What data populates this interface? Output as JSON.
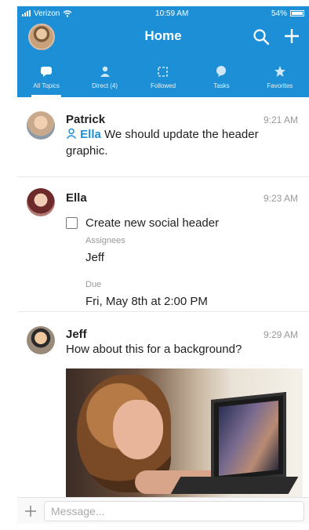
{
  "status_bar": {
    "carrier": "Verizon",
    "time": "10:59 AM",
    "battery": "54%"
  },
  "header": {
    "title": "Home"
  },
  "tabs": [
    {
      "label": "All Topics",
      "icon": "chat-bubble-icon",
      "active": true
    },
    {
      "label": "Direct (4)",
      "icon": "person-icon",
      "active": false
    },
    {
      "label": "Followed",
      "icon": "puzzle-icon",
      "active": false
    },
    {
      "label": "Tasks",
      "icon": "bubble-icon",
      "active": false
    },
    {
      "label": "Favorites",
      "icon": "star-icon",
      "active": false
    }
  ],
  "messages": [
    {
      "author": "Patrick",
      "time": "9:21 AM",
      "mention": "Ella",
      "text": "We should update the header graphic."
    },
    {
      "author": "Ella",
      "time": "9:23 AM",
      "task": {
        "title": "Create new social header",
        "assignees_label": "Assignees",
        "assignee": "Jeff",
        "due_label": "Due",
        "due": "Fri, May 8th at 2:00 PM"
      }
    },
    {
      "author": "Jeff",
      "time": "9:29 AM",
      "text": "How about this for a background?"
    }
  ],
  "composer": {
    "placeholder": "Message..."
  },
  "colors": {
    "brand": "#1d8fd6",
    "mention": "#1d8fd6"
  }
}
